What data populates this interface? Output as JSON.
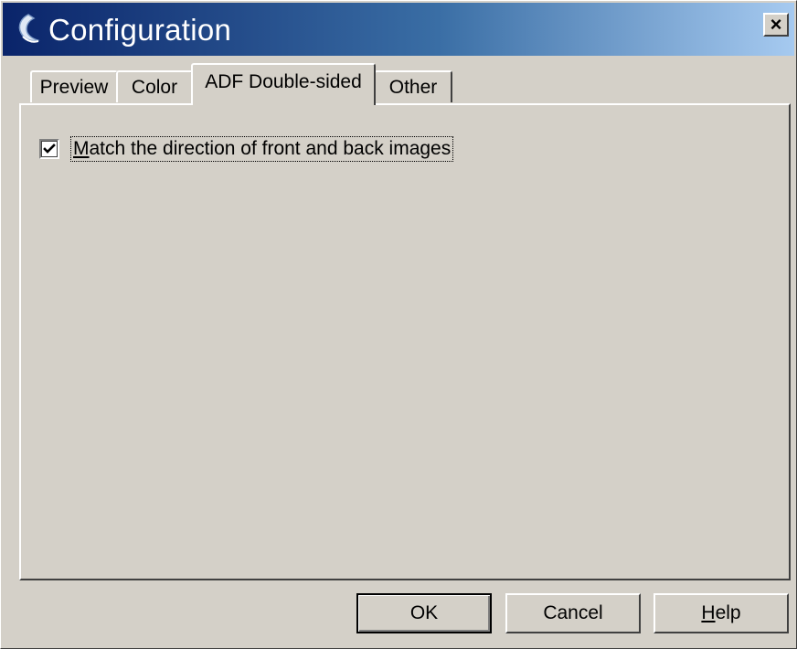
{
  "window": {
    "title": "Configuration",
    "close_label": "×"
  },
  "tabs": [
    {
      "label": "Preview",
      "active": false
    },
    {
      "label": "Color",
      "active": false
    },
    {
      "label": "ADF Double-sided",
      "active": true
    },
    {
      "label": "Other",
      "active": false
    }
  ],
  "panel": {
    "match_direction": {
      "label": "Match the direction of front and back images",
      "checked": true
    }
  },
  "buttons": {
    "ok": "OK",
    "cancel": "Cancel",
    "help": "Help"
  },
  "icons": {
    "app": "scanner-app-icon",
    "close": "close-icon",
    "check": "check-icon"
  },
  "colors": {
    "titlebar_start": "#0a246a",
    "titlebar_end": "#a6caf0",
    "face": "#d4d0c8"
  }
}
